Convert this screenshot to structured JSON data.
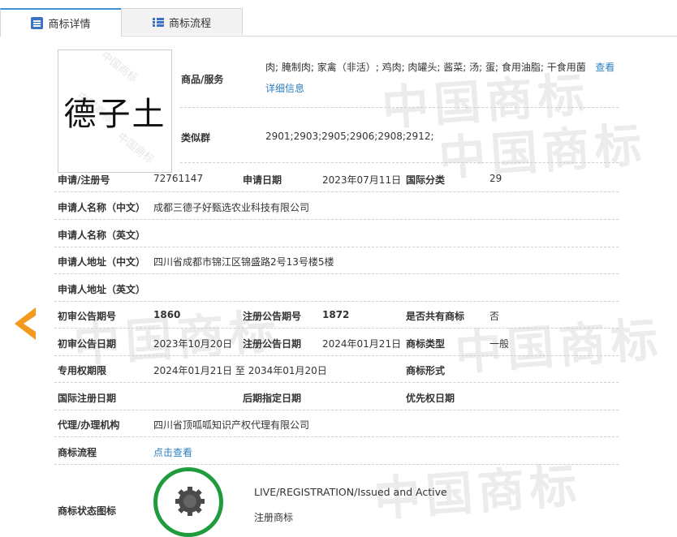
{
  "tabs": [
    {
      "label": "商标详情",
      "icon": "list-detail-icon",
      "active": true
    },
    {
      "label": "商标流程",
      "icon": "list-flow-icon",
      "active": false
    }
  ],
  "mark": {
    "image_text": "德子土",
    "watermark_text": "中国商标"
  },
  "goods_services": {
    "label": "商品/服务",
    "value": "肉; 腌制肉; 家禽（非活）; 鸡肉; 肉罐头; 酱菜; 汤; 蛋; 食用油脂; 干食用菌",
    "more_link": "查看详细信息"
  },
  "similar_group": {
    "label": "类似群",
    "value": "2901;2903;2905;2906;2908;2912;"
  },
  "fields": {
    "reg_no": {
      "label": "申请/注册号",
      "value": "72761147"
    },
    "app_date": {
      "label": "申请日期",
      "value": "2023年07月11日"
    },
    "intl_class": {
      "label": "国际分类",
      "value": "29"
    },
    "applicant_cn": {
      "label": "申请人名称（中文）",
      "value": "成都三德子好甄选农业科技有限公司"
    },
    "applicant_en": {
      "label": "申请人名称（英文）",
      "value": ""
    },
    "address_cn": {
      "label": "申请人地址（中文）",
      "value": "四川省成都市锦江区锦盛路2号13号楼5楼"
    },
    "address_en": {
      "label": "申请人地址（英文）",
      "value": ""
    },
    "prelim_pub_no": {
      "label": "初审公告期号",
      "value": "1860"
    },
    "reg_pub_no": {
      "label": "注册公告期号",
      "value": "1872"
    },
    "shared": {
      "label": "是否共有商标",
      "value": "否"
    },
    "prelim_pub_date": {
      "label": "初审公告日期",
      "value": "2023年10月20日"
    },
    "reg_pub_date": {
      "label": "注册公告日期",
      "value": "2024年01月21日"
    },
    "mark_type": {
      "label": "商标类型",
      "value": "一般"
    },
    "exclusive_period": {
      "label": "专用权期限",
      "value": "2024年01月21日 至 2034年01月20日"
    },
    "mark_form": {
      "label": "商标形式",
      "value": ""
    },
    "intl_reg_date": {
      "label": "国际注册日期",
      "value": ""
    },
    "later_designation_date": {
      "label": "后期指定日期",
      "value": ""
    },
    "priority_date": {
      "label": "优先权日期",
      "value": ""
    },
    "agent": {
      "label": "代理/办理机构",
      "value": "四川省顶呱呱知识产权代理有限公司"
    },
    "process": {
      "label": "商标流程",
      "value": "点击查看"
    },
    "status_icon": {
      "label": "商标状态图标",
      "status_en": "LIVE/REGISTRATION/Issued and Active",
      "status_cn": "注册商标"
    }
  },
  "background_watermark": "中国商标",
  "colors": {
    "accent": "#2b7fc1",
    "arrow": "#f39a1e",
    "status_ring": "#1e9b3c",
    "tab_top": "#3e8fd6"
  }
}
